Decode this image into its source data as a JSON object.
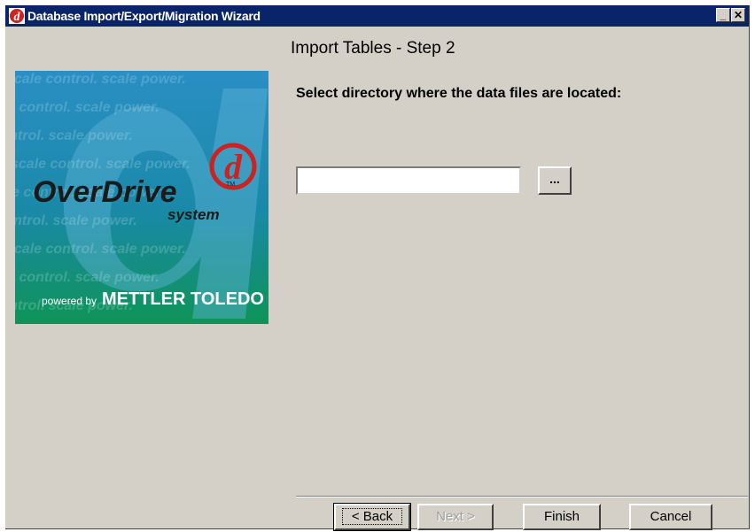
{
  "window": {
    "title": "Database Import/Export/Migration Wizard",
    "minimize_glyph": "_",
    "close_glyph": "✕"
  },
  "logo": {
    "brand": "OverDrive",
    "tm": "TM",
    "subbrand": "system",
    "powered_by": "powered by",
    "company": "METTLER TOLEDO",
    "watermark": "scale control. scale power.",
    "emblem_letter": "d"
  },
  "step": {
    "heading": "Import Tables - Step 2",
    "prompt": "Select directory where the data files are located:"
  },
  "directory": {
    "value": "",
    "browse_label": "..."
  },
  "buttons": {
    "back": "< Back",
    "next": "Next >",
    "finish": "Finish",
    "cancel": "Cancel"
  },
  "colors": {
    "titlebar": "#0a246a",
    "face": "#d4d0c8",
    "logo_blue": "#1f86b8",
    "logo_green": "#119460",
    "brand_red": "#cc2222"
  }
}
